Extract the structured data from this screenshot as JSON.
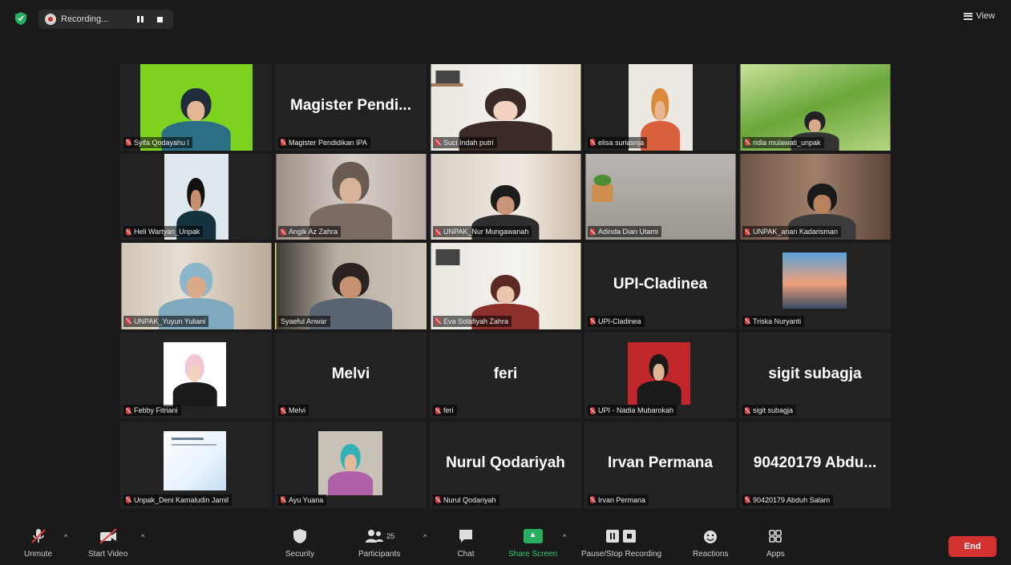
{
  "recording": {
    "label": "Recording...",
    "pause_icon": "pause-icon",
    "stop_icon": "stop-icon"
  },
  "view": {
    "label": "View"
  },
  "participants": [
    {
      "tag": "Syifa Qodayahu l",
      "big": ""
    },
    {
      "tag": "Magister Pendidikan IPA",
      "big": "Magister Pendi..."
    },
    {
      "tag": "Suci Indah putri",
      "big": ""
    },
    {
      "tag": "elisa suriasnja",
      "big": ""
    },
    {
      "tag": "ridla mulawati_unpak",
      "big": ""
    },
    {
      "tag": "Heli Wartyan_Unpak",
      "big": ""
    },
    {
      "tag": "Angik Az Zahra",
      "big": ""
    },
    {
      "tag": "UNPAK_Nur Mungawanah",
      "big": ""
    },
    {
      "tag": "Adinda Dian Utami",
      "big": ""
    },
    {
      "tag": "UNPAK_anan Kadarisman",
      "big": ""
    },
    {
      "tag": "UNPAK_Yuyun Yuliani",
      "big": ""
    },
    {
      "tag": "Syaeful Anwar",
      "big": ""
    },
    {
      "tag": "Eva Solafiyah Zahra",
      "big": ""
    },
    {
      "tag": "UPI-Cladinea",
      "big": "UPI-Cladinea"
    },
    {
      "tag": "Triska Nuryanti",
      "big": ""
    },
    {
      "tag": "Febby Fitriani",
      "big": ""
    },
    {
      "tag": "Melvi",
      "big": "Melvi"
    },
    {
      "tag": "feri",
      "big": "feri"
    },
    {
      "tag": "UPI - Nadia Mubarokah",
      "big": ""
    },
    {
      "tag": "sigit subagja",
      "big": "sigit subagja"
    },
    {
      "tag": "Unpak_Deni Kamaludin Jamil",
      "big": ""
    },
    {
      "tag": "Ayu Yuana",
      "big": ""
    },
    {
      "tag": "Nurul Qodariyah",
      "big": "Nurul Qodariyah"
    },
    {
      "tag": "Irvan Permana",
      "big": "Irvan Permana"
    },
    {
      "tag": "90420179 Abduh Salam",
      "big": "90420179 Abdu..."
    }
  ],
  "toolbar": {
    "unmute": "Unmute",
    "start_video": "Start Video",
    "security": "Security",
    "participants": "Participants",
    "participants_count": "25",
    "chat": "Chat",
    "share_screen": "Share Screen",
    "pause_stop_recording": "Pause/Stop Recording",
    "reactions": "Reactions",
    "apps": "Apps",
    "end": "End"
  },
  "colors": {
    "share_green": "#2ecc71",
    "end_red": "#d43131",
    "active_speaker": "#f1e04a"
  }
}
